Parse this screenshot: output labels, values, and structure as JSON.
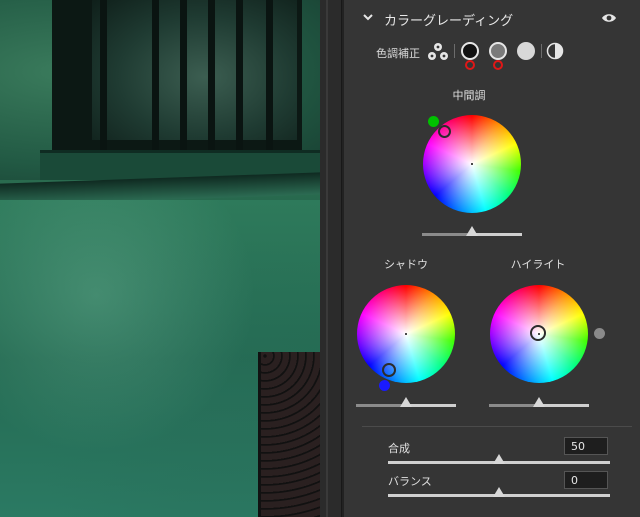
{
  "panel": {
    "title": "カラーグレーディング",
    "adjust_label": "色調補正",
    "midtones_label": "中間調",
    "shadows_label": "シャドウ",
    "highlights_label": "ハイライト",
    "blending_label": "合成",
    "blending_value": "50",
    "balance_label": "バランス",
    "balance_value": "0"
  },
  "sliders": {
    "midtones_luminance": 0.5,
    "shadows_luminance": 0.5,
    "highlights_luminance": 0.5,
    "blending": 0.5,
    "balance": 0.5
  },
  "colors": {
    "panel_bg": "#353535",
    "mode_indicator": "#e01717",
    "midtone_handle": "#00c000",
    "shadow_handle": "#1a1aff",
    "highlight_handle": "#8a8a8a"
  },
  "icons": [
    "chevron-down-icon",
    "eye-icon",
    "three-way-icon",
    "shadow-mode-icon",
    "midtone-mode-icon",
    "highlight-mode-icon",
    "global-mode-icon"
  ]
}
